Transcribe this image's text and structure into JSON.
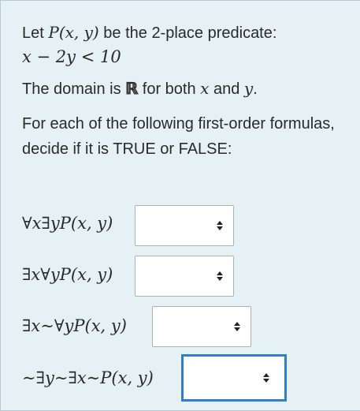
{
  "intro": {
    "line1_prefix": "Let ",
    "predicate": "P(x, y)",
    "line1_suffix": " be the 2-place predicate:",
    "predicate_formula": "x − 2y < 10"
  },
  "domain": {
    "prefix": "The domain is ",
    "set_symbol": "ℝ",
    "middle": " for both ",
    "var1": "x",
    "and": " and ",
    "var2": "y",
    "suffix": "."
  },
  "instructions": "For each of the following first-order formulas, decide if it is TRUE or FALSE:",
  "questions": [
    {
      "formula": "∀x∃yP(x, y)",
      "selected": ""
    },
    {
      "formula": "∃x∀yP(x, y)",
      "selected": ""
    },
    {
      "formula": "∃x∼∀yP(x, y)",
      "selected": ""
    },
    {
      "formula": "∼∃y∼∃x∼P(x, y)",
      "selected": ""
    }
  ],
  "colors": {
    "panel_background": "#e6f1f5",
    "focus_border": "#2f7ec9"
  }
}
